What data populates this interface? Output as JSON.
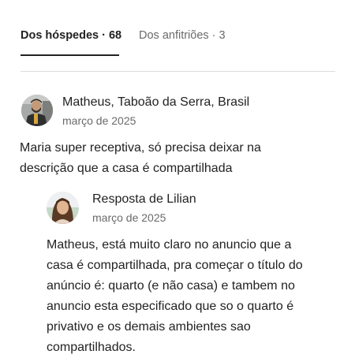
{
  "tabs": {
    "guests": "Dos hóspedes · 68",
    "hosts": "Dos anfitriões · 3"
  },
  "review": {
    "author": "Matheus, Taboão da Serra, Brasil",
    "date": "março de 2025",
    "text_lines": [
      "Maria super receptiva, só precisa deixar na",
      "descrição que a casa é compartilhada"
    ]
  },
  "reply": {
    "title": "Resposta de Lilian",
    "date": "março de 2025",
    "text_lines": [
      "Matheus, está muito claro no anuncio que a",
      "casa é compartilhada, pra começar o título do",
      "anúncio é: quarto (e não casa) e tambem no",
      "anuncio esta especificado que so o quarto é",
      "privativo e os demais ambientes sao",
      "compartilhados."
    ]
  }
}
